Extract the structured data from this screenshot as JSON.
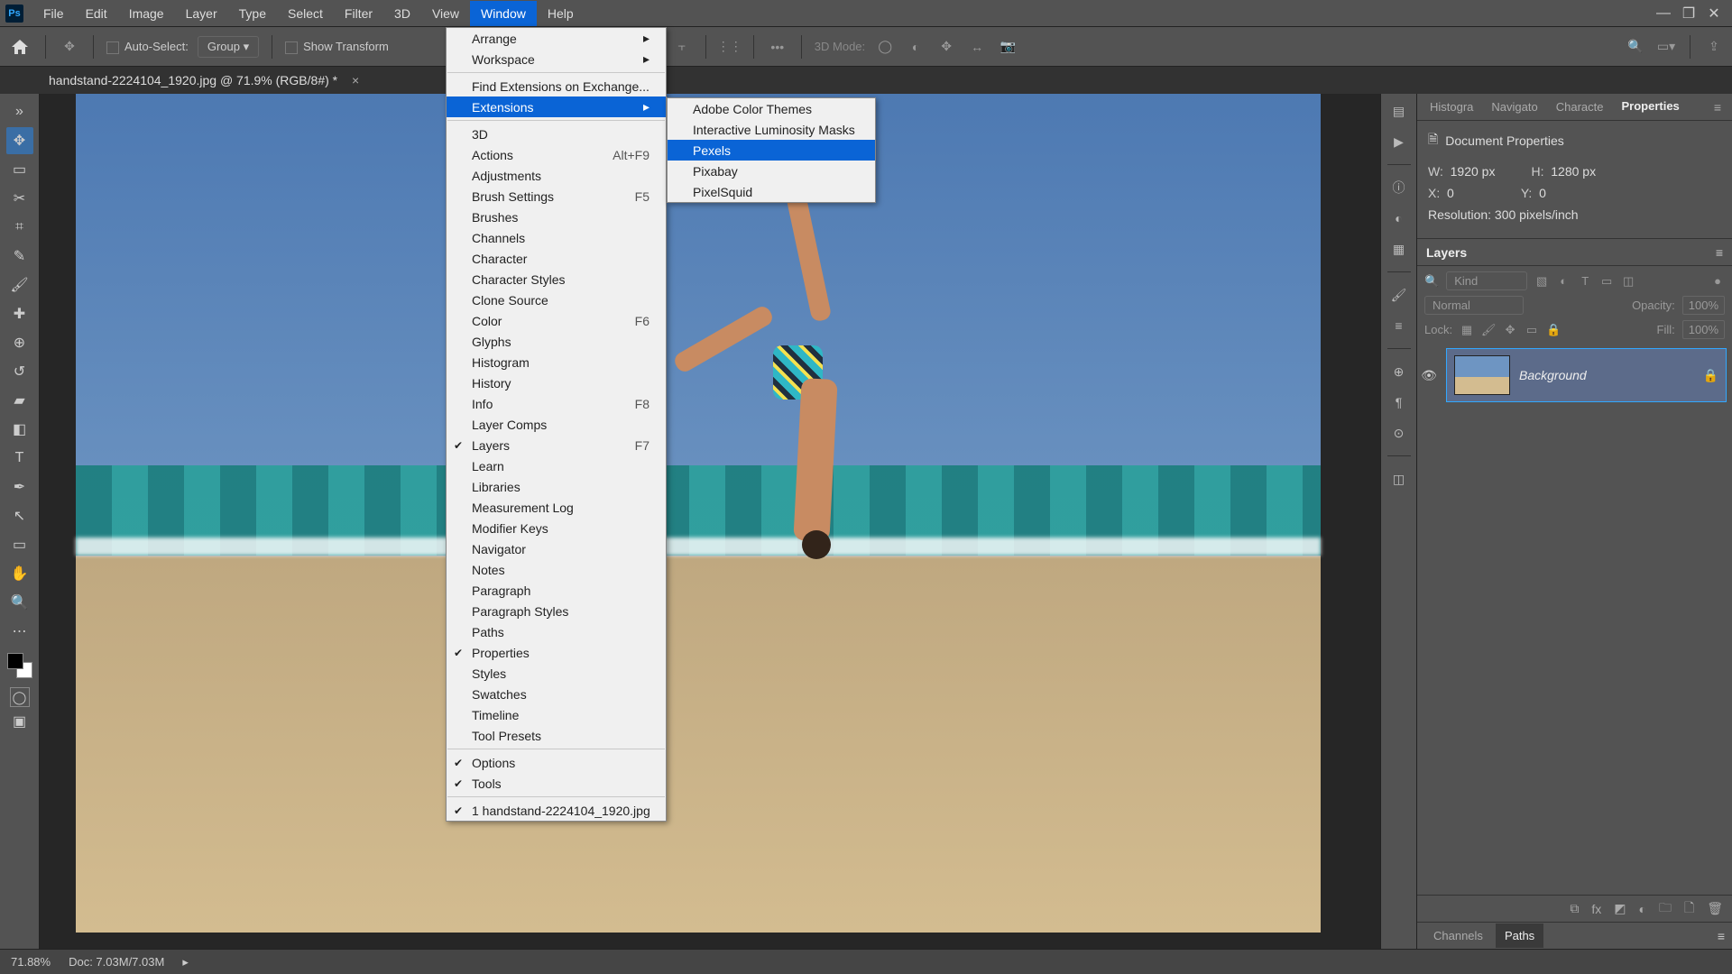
{
  "menubar": {
    "items": [
      "File",
      "Edit",
      "Image",
      "Layer",
      "Type",
      "Select",
      "Filter",
      "3D",
      "View",
      "Window",
      "Help"
    ],
    "active": 9
  },
  "optbar": {
    "auto_select": "Auto-Select:",
    "group": "Group",
    "show_transform": "Show Transform",
    "mode3d": "3D Mode:"
  },
  "doctab": {
    "title": "handstand-2224104_1920.jpg @ 71.9% (RGB/8#) *"
  },
  "winmenu": {
    "arrange": "Arrange",
    "workspace": "Workspace",
    "findext": "Find Extensions on Exchange...",
    "extensions": "Extensions",
    "threeD": "3D",
    "actions": "Actions",
    "actions_sc": "Alt+F9",
    "adjustments": "Adjustments",
    "brushset": "Brush Settings",
    "brushset_sc": "F5",
    "brushes": "Brushes",
    "channels": "Channels",
    "character": "Character",
    "charstyles": "Character Styles",
    "clone": "Clone Source",
    "color": "Color",
    "color_sc": "F6",
    "glyphs": "Glyphs",
    "histogram": "Histogram",
    "history": "History",
    "info": "Info",
    "info_sc": "F8",
    "layercomps": "Layer Comps",
    "layers": "Layers",
    "layers_sc": "F7",
    "learn": "Learn",
    "libraries": "Libraries",
    "measlog": "Measurement Log",
    "modkeys": "Modifier Keys",
    "navigator": "Navigator",
    "notes": "Notes",
    "paragraph": "Paragraph",
    "parastyles": "Paragraph Styles",
    "paths": "Paths",
    "properties": "Properties",
    "styles": "Styles",
    "swatches": "Swatches",
    "timeline": "Timeline",
    "toolpresets": "Tool Presets",
    "options": "Options",
    "tools": "Tools",
    "doc1": "1 handstand-2224104_1920.jpg"
  },
  "extmenu": {
    "adobe": "Adobe Color Themes",
    "ilm": "Interactive Luminosity Masks",
    "pexels": "Pexels",
    "pixabay": "Pixabay",
    "pixelsquid": "PixelSquid"
  },
  "proptabs": {
    "histogram": "Histogra",
    "navigator": "Navigato",
    "character": "Characte",
    "properties": "Properties"
  },
  "props": {
    "doc_title": "Document Properties",
    "w_lbl": "W:",
    "w_val": "1920 px",
    "h_lbl": "H:",
    "h_val": "1280 px",
    "x_lbl": "X:",
    "x_val": "0",
    "y_lbl": "Y:",
    "y_val": "0",
    "res": "Resolution: 300 pixels/inch"
  },
  "layerpanel": {
    "title": "Layers",
    "kind_ph": "Kind",
    "blend": "Normal",
    "opacity_lbl": "Opacity:",
    "opacity_val": "100%",
    "lock_lbl": "Lock:",
    "fill_lbl": "Fill:",
    "fill_val": "100%",
    "layer_name": "Background"
  },
  "bottomtabs": {
    "channels": "Channels",
    "paths": "Paths"
  },
  "status": {
    "zoom": "71.88%",
    "docsize": "Doc: 7.03M/7.03M"
  }
}
